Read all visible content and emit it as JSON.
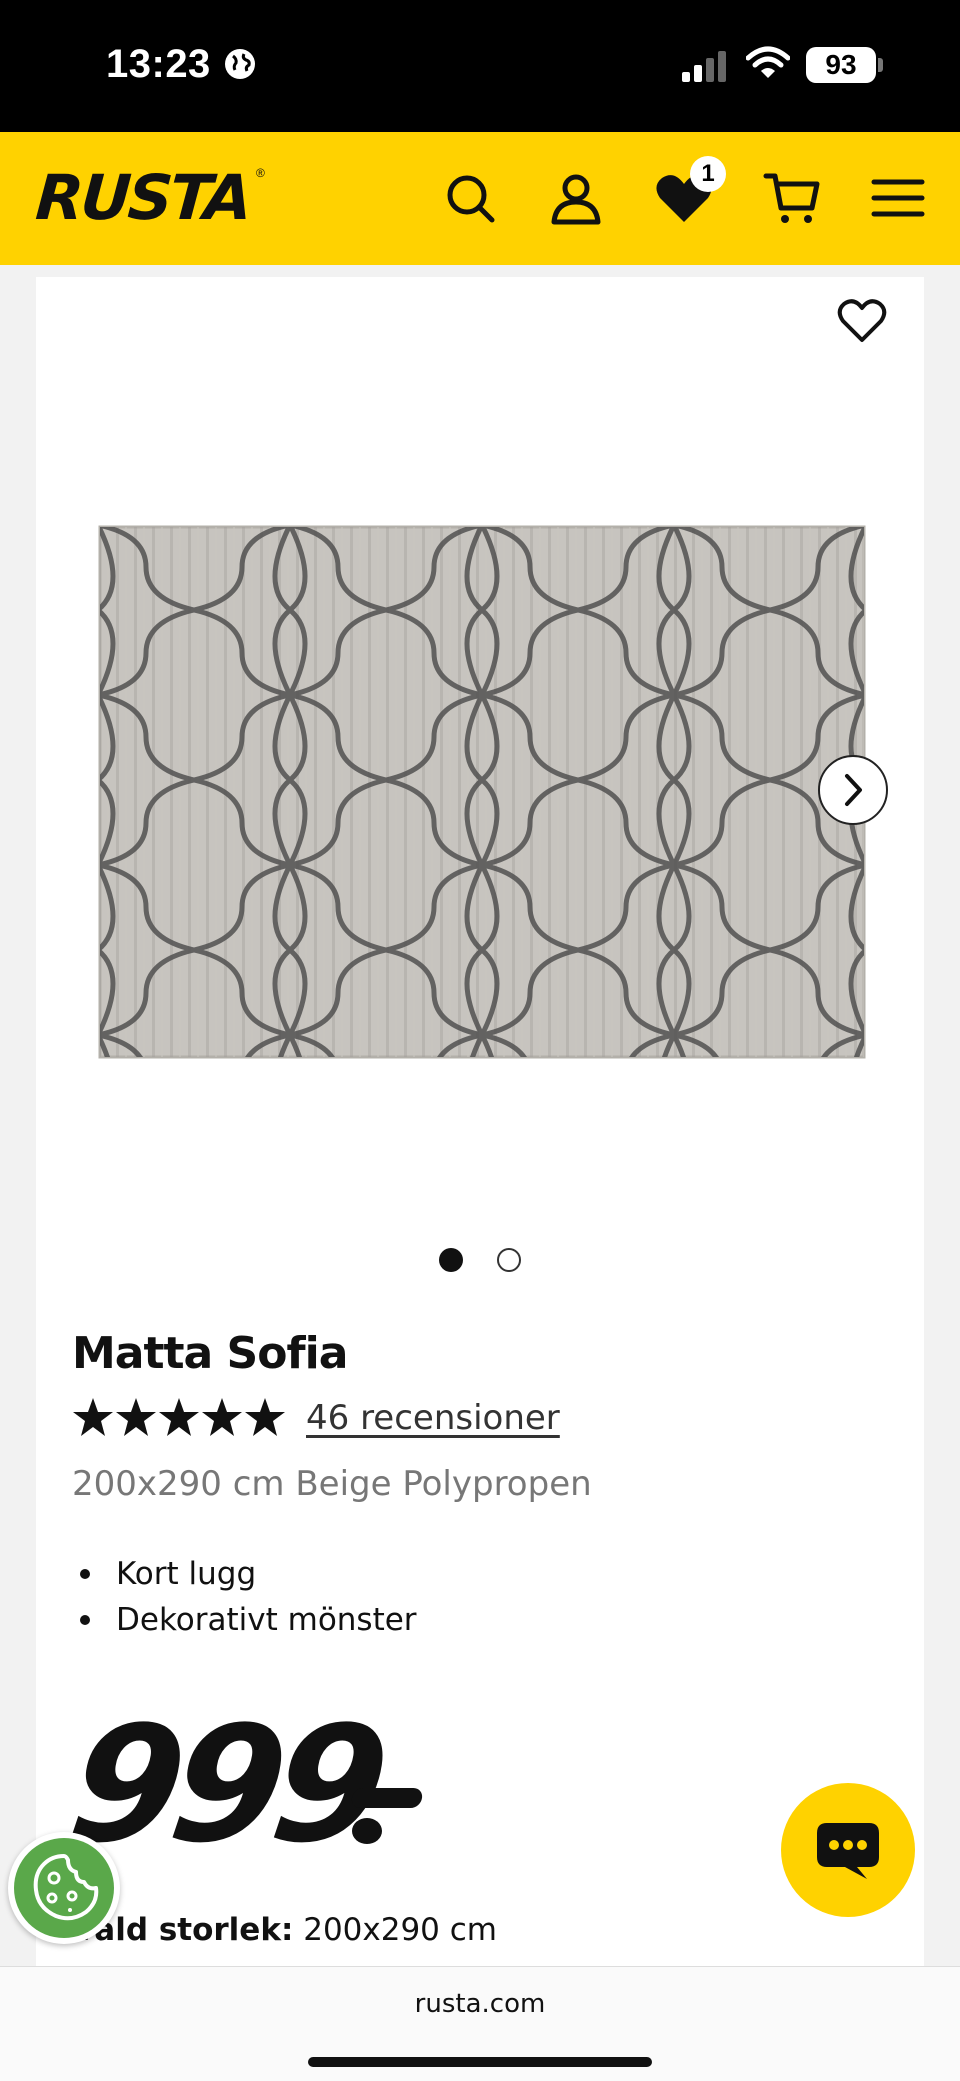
{
  "status_bar": {
    "time": "13:23",
    "battery": "93",
    "icons": [
      "globe-icon",
      "signal-icon",
      "wifi-icon",
      "battery-icon"
    ]
  },
  "header": {
    "logo": "RUSTA",
    "logo_mark": "®",
    "icons": [
      "search-icon",
      "account-icon",
      "heart-icon",
      "cart-icon",
      "menu-icon"
    ],
    "wishlist_count": "1",
    "background_color": "#ffd200"
  },
  "product": {
    "title": "Matta Sofia",
    "rating": 5,
    "rating_max": 5,
    "reviews_text": "46 recensioner",
    "subtitle": "200x290 cm Beige Polypropen",
    "features": [
      "Kort lugg",
      "Dekorativt mönster"
    ],
    "price": "999",
    "price_suffix": "-",
    "size_label": "Vald storlek:",
    "size_value": "200x290 cm",
    "gallery": {
      "current_image": 1,
      "total_images": 2
    }
  },
  "floating": {
    "chat_icon": "chat-icon",
    "cookie_icon": "cookie-icon"
  },
  "browser": {
    "url": "rusta.com"
  }
}
